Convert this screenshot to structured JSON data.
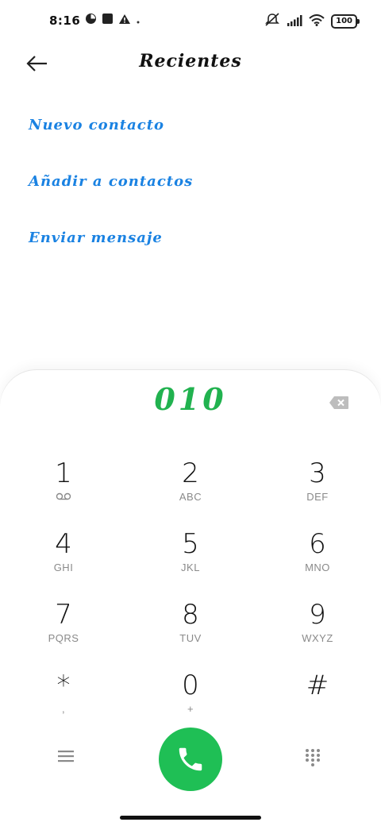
{
  "status_bar": {
    "time": "8:16",
    "battery": "100",
    "left_icons": [
      "data-saver-icon",
      "app-notification-icon",
      "warning-icon",
      "dot-icon"
    ],
    "right_icons": [
      "muted-vibrate-icon",
      "signal-icon",
      "wifi-icon",
      "battery-icon"
    ]
  },
  "header": {
    "title": "Recientes",
    "back_icon": "arrow-left-icon"
  },
  "actions": [
    {
      "label": "Nuevo contacto"
    },
    {
      "label": "Añadir a contactos"
    },
    {
      "label": "Enviar mensaje"
    }
  ],
  "dialer": {
    "number": "010",
    "number_color": "#21b24f",
    "delete_icon": "backspace-icon",
    "keys": [
      {
        "digit": "1",
        "letters": "",
        "sub_icon": "voicemail-icon"
      },
      {
        "digit": "2",
        "letters": "ABC"
      },
      {
        "digit": "3",
        "letters": "DEF"
      },
      {
        "digit": "4",
        "letters": "GHI"
      },
      {
        "digit": "5",
        "letters": "JKL"
      },
      {
        "digit": "6",
        "letters": "MNO"
      },
      {
        "digit": "7",
        "letters": "PQRS"
      },
      {
        "digit": "8",
        "letters": "TUV"
      },
      {
        "digit": "9",
        "letters": "WXYZ"
      },
      {
        "digit": "*",
        "letters": ","
      },
      {
        "digit": "0",
        "letters": "+"
      },
      {
        "digit": "#",
        "letters": ""
      }
    ],
    "bottom": {
      "menu_icon": "menu-icon",
      "call_icon": "phone-icon",
      "call_color": "#1fbf55",
      "keypad_icon": "dialpad-icon"
    }
  },
  "colors": {
    "accent_link": "#1a82e2",
    "call_green": "#1fbf55"
  }
}
